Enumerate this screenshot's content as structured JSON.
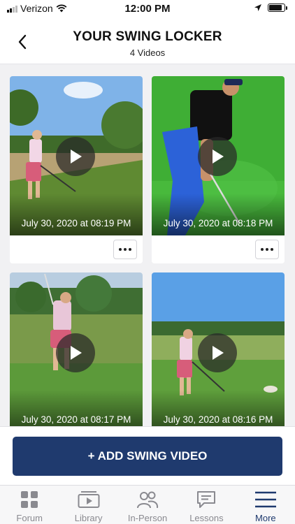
{
  "status_bar": {
    "carrier": "Verizon",
    "time": "12:00 PM",
    "battery_level": 0.85
  },
  "header": {
    "title": "YOUR SWING LOCKER",
    "subtitle": "4 Videos",
    "back_icon": "chevron-left-icon"
  },
  "videos": [
    {
      "date": "July 30, 2020 at 08:19 PM",
      "play_icon": "play-icon",
      "more_icon": "ellipsis-icon"
    },
    {
      "date": "July 30, 2020 at 08:18 PM",
      "play_icon": "play-icon",
      "more_icon": "ellipsis-icon"
    },
    {
      "date": "July 30, 2020 at 08:17 PM",
      "play_icon": "play-icon",
      "more_icon": "ellipsis-icon"
    },
    {
      "date": "July 30, 2020 at 08:16 PM",
      "play_icon": "play-icon",
      "more_icon": "ellipsis-icon"
    }
  ],
  "add_button": {
    "label": "+ ADD SWING VIDEO"
  },
  "tabs": [
    {
      "label": "Forum",
      "icon": "grid-icon",
      "active": false
    },
    {
      "label": "Library",
      "icon": "video-library-icon",
      "active": false
    },
    {
      "label": "In-Person",
      "icon": "people-icon",
      "active": false
    },
    {
      "label": "Lessons",
      "icon": "chat-icon",
      "active": false
    },
    {
      "label": "More",
      "icon": "menu-icon",
      "active": true
    }
  ],
  "colors": {
    "brand": "#1f3a6e",
    "tab_inactive": "#8a8a90",
    "background": "#f1f1f3"
  }
}
